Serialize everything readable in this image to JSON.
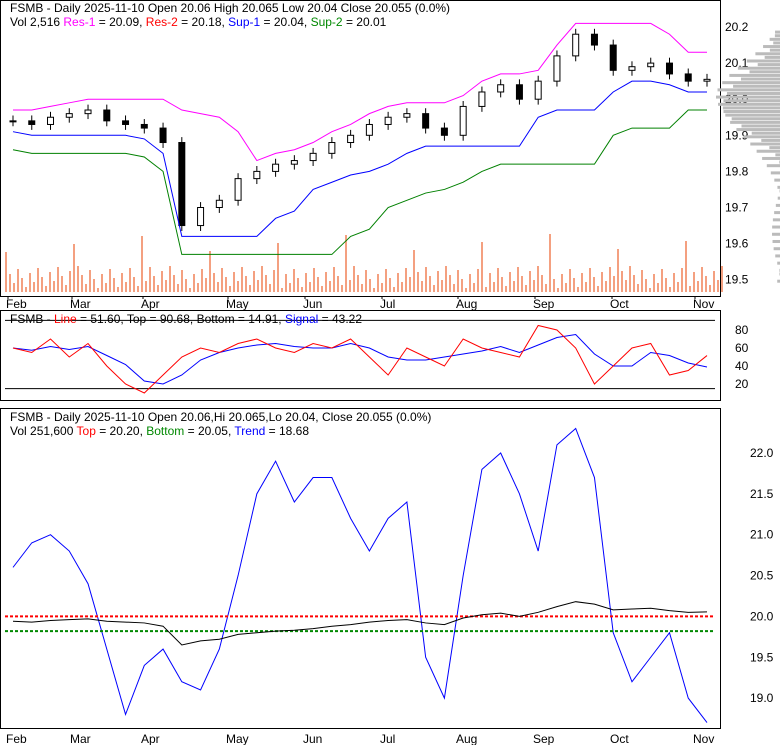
{
  "colors": {
    "res1": "#ff00ff",
    "res2": "#ff0000",
    "sup1": "#0000ff",
    "sup2": "#008000",
    "volume": "#f4a080"
  },
  "panel1": {
    "title": "FSMB - Daily 2025-11-10 Open 20.06  High 20.065  Low 20.04  Close 20.055 (0.0%)",
    "vol": "Vol 2,516",
    "res1": "Res-1",
    "res1_val": " = 20.09, ",
    "res2": "Res-2",
    "res2_val": " = 20.18, ",
    "sup1": "Sup-1",
    "sup1_val": " = 20.04, ",
    "sup2": "Sup-2",
    "sup2_val": " = 20.01"
  },
  "panel2": {
    "prefix": "FSMB - ",
    "line": "Line",
    "line_val": " = 51.60, Top = 90.68, Bottom = 14.91, ",
    "signal": "Signal",
    "signal_val": " = 43.22"
  },
  "panel3": {
    "title": "FSMB - Daily 2025-11-10 Open 20.06,Hi 20.065,Lo 20.04, Close 20.055 (0.0%)",
    "vol": "Vol 251,600 ",
    "top": "Top",
    "top_val": " = 20.20, ",
    "bottom": "Bottom",
    "bottom_val": " = 20.05, ",
    "trend": "Trend",
    "trend_val": " = 18.68"
  },
  "chart_data": [
    {
      "type": "candlestick",
      "title": "FSMB Daily price",
      "ylim": [
        19.45,
        20.22
      ],
      "yticks": [
        "20.2",
        "20.1",
        "20.0",
        "19.9",
        "19.8",
        "19.7",
        "19.6",
        "19.5"
      ],
      "months": [
        "Feb",
        "Mar",
        "Apr",
        "May",
        "Jun",
        "Jul",
        "Aug",
        "Sep",
        "Oct",
        "Nov"
      ],
      "close": [
        19.94,
        19.93,
        19.95,
        19.96,
        19.97,
        19.94,
        19.93,
        19.92,
        19.88,
        19.65,
        19.7,
        19.72,
        19.78,
        19.8,
        19.82,
        19.83,
        19.85,
        19.88,
        19.9,
        19.93,
        19.95,
        19.96,
        19.92,
        19.9,
        19.98,
        20.02,
        20.04,
        20.0,
        20.05,
        20.12,
        20.18,
        20.15,
        20.08,
        20.09,
        20.1,
        20.07,
        20.05,
        20.055
      ],
      "res1": 20.09,
      "res2": 20.18,
      "sup1": 20.04,
      "sup2": 20.01
    },
    {
      "type": "line",
      "title": "Stochastic",
      "ylim": [
        0,
        100
      ],
      "yticks": [
        "80",
        "60",
        "40",
        "20"
      ],
      "line": [
        60,
        55,
        70,
        50,
        65,
        40,
        20,
        10,
        30,
        50,
        60,
        55,
        65,
        70,
        60,
        55,
        65,
        60,
        70,
        50,
        30,
        60,
        50,
        40,
        70,
        60,
        55,
        50,
        85,
        80,
        60,
        20,
        40,
        60,
        65,
        30,
        35,
        51.6
      ],
      "top": 90.68,
      "bottom": 14.91,
      "signal_last": 43.22
    },
    {
      "type": "line",
      "title": "Trend",
      "ylim": [
        18.6,
        22.5
      ],
      "yticks": [
        "22.0",
        "21.5",
        "21.0",
        "20.5",
        "20.0",
        "19.5",
        "19.0"
      ],
      "trend": [
        20.6,
        20.9,
        21.0,
        20.8,
        20.4,
        19.6,
        18.8,
        19.4,
        19.6,
        19.2,
        19.1,
        19.6,
        20.5,
        21.5,
        21.9,
        21.4,
        21.7,
        21.7,
        21.2,
        20.8,
        21.2,
        21.4,
        19.5,
        19.0,
        20.5,
        21.8,
        22.0,
        21.5,
        20.8,
        22.1,
        22.3,
        21.7,
        19.8,
        19.2,
        19.5,
        19.8,
        19.0,
        18.7
      ],
      "top": 20.2,
      "bottom": 20.05
    }
  ]
}
